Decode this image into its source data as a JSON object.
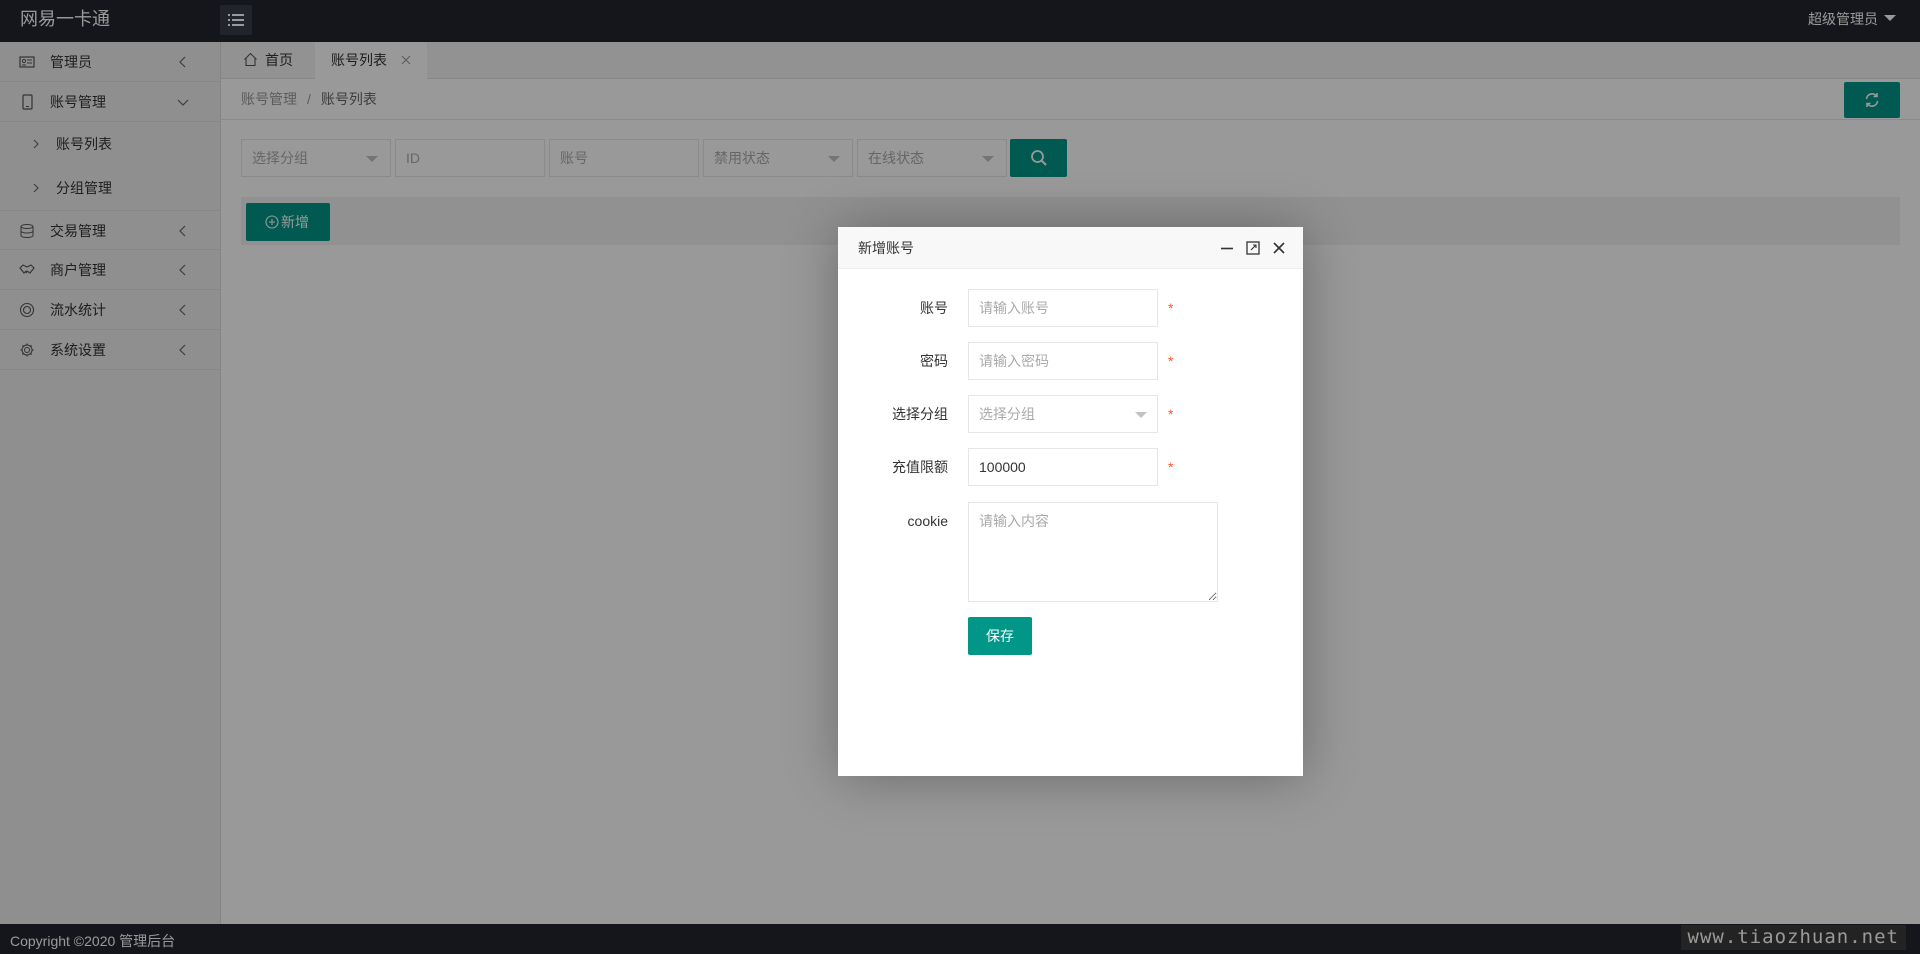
{
  "app": {
    "title": "网易一卡通",
    "user": "超级管理员"
  },
  "sidebar": {
    "items": [
      {
        "label": "管理员"
      },
      {
        "label": "账号管理",
        "children": [
          {
            "label": "账号列表"
          },
          {
            "label": "分组管理"
          }
        ]
      },
      {
        "label": "交易管理"
      },
      {
        "label": "商户管理"
      },
      {
        "label": "流水统计"
      },
      {
        "label": "系统设置"
      }
    ]
  },
  "tabs": [
    {
      "label": "首页"
    },
    {
      "label": "账号列表"
    }
  ],
  "breadcrumb": {
    "parent": "账号管理",
    "separator": "/",
    "current": "账号列表"
  },
  "filters": {
    "group": "选择分组",
    "id": "ID",
    "account": "账号",
    "ban_status": "禁用状态",
    "online_status": "在线状态"
  },
  "toolbar": {
    "add_label": "新增"
  },
  "modal": {
    "title": "新增账号",
    "fields": {
      "account": {
        "label": "账号",
        "placeholder": "请输入账号",
        "value": ""
      },
      "password": {
        "label": "密码",
        "placeholder": "请输入密码",
        "value": ""
      },
      "group": {
        "label": "选择分组",
        "selected": "选择分组"
      },
      "limit": {
        "label": "充值限额",
        "value": "100000"
      },
      "cookie": {
        "label": "cookie",
        "placeholder": "请输入内容",
        "value": ""
      }
    },
    "required_mark": "*",
    "save_label": "保存"
  },
  "footer": {
    "copyright": "Copyright ©2020 管理后台"
  },
  "watermark": "www.tiaozhuan.net",
  "colors": {
    "header": "#23262e",
    "accent": "#009688",
    "required": "#ff5722",
    "sidebar": "#eeeeee"
  }
}
